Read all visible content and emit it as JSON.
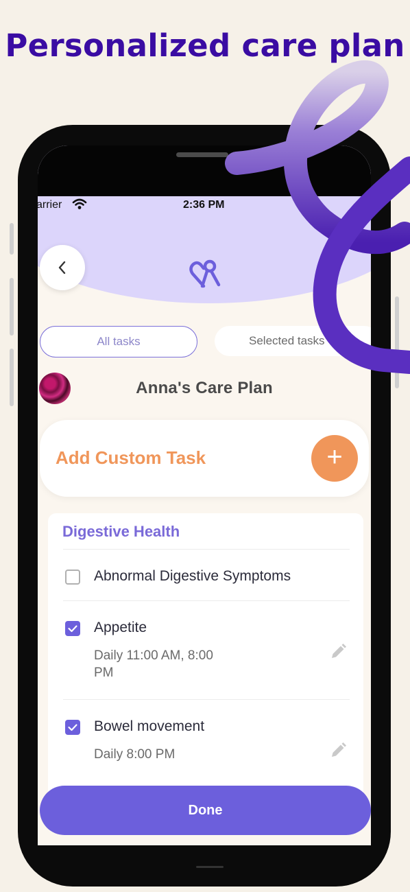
{
  "headline": "Personalized care plan",
  "status_bar": {
    "carrier": "arrier",
    "time": "2:36 PM"
  },
  "header": {
    "back_icon": "chevron-left-icon",
    "logo_icon": "heart-figure-logo-icon"
  },
  "tabs": [
    {
      "label": "All tasks",
      "active": true
    },
    {
      "label": "Selected tasks",
      "active": false
    }
  ],
  "plan_title": "Anna's Care Plan",
  "add_task": {
    "label": "Add Custom Task",
    "button_symbol": "+"
  },
  "section": {
    "title": "Digestive Health",
    "tasks": [
      {
        "name": "Abnormal Digestive Symptoms",
        "checked": false,
        "schedule": ""
      },
      {
        "name": "Appetite",
        "checked": true,
        "schedule": "Daily 11:00 AM, 8:00 PM"
      },
      {
        "name": "Bowel movement",
        "checked": true,
        "schedule": "Daily 8:00 PM"
      }
    ]
  },
  "done_label": "Done",
  "colors": {
    "headline": "#3a0ca3",
    "accent": "#6c5fdc",
    "orange": "#f0965a",
    "header_bg": "#dcd5fb",
    "page_bg": "#f6f1e8"
  }
}
